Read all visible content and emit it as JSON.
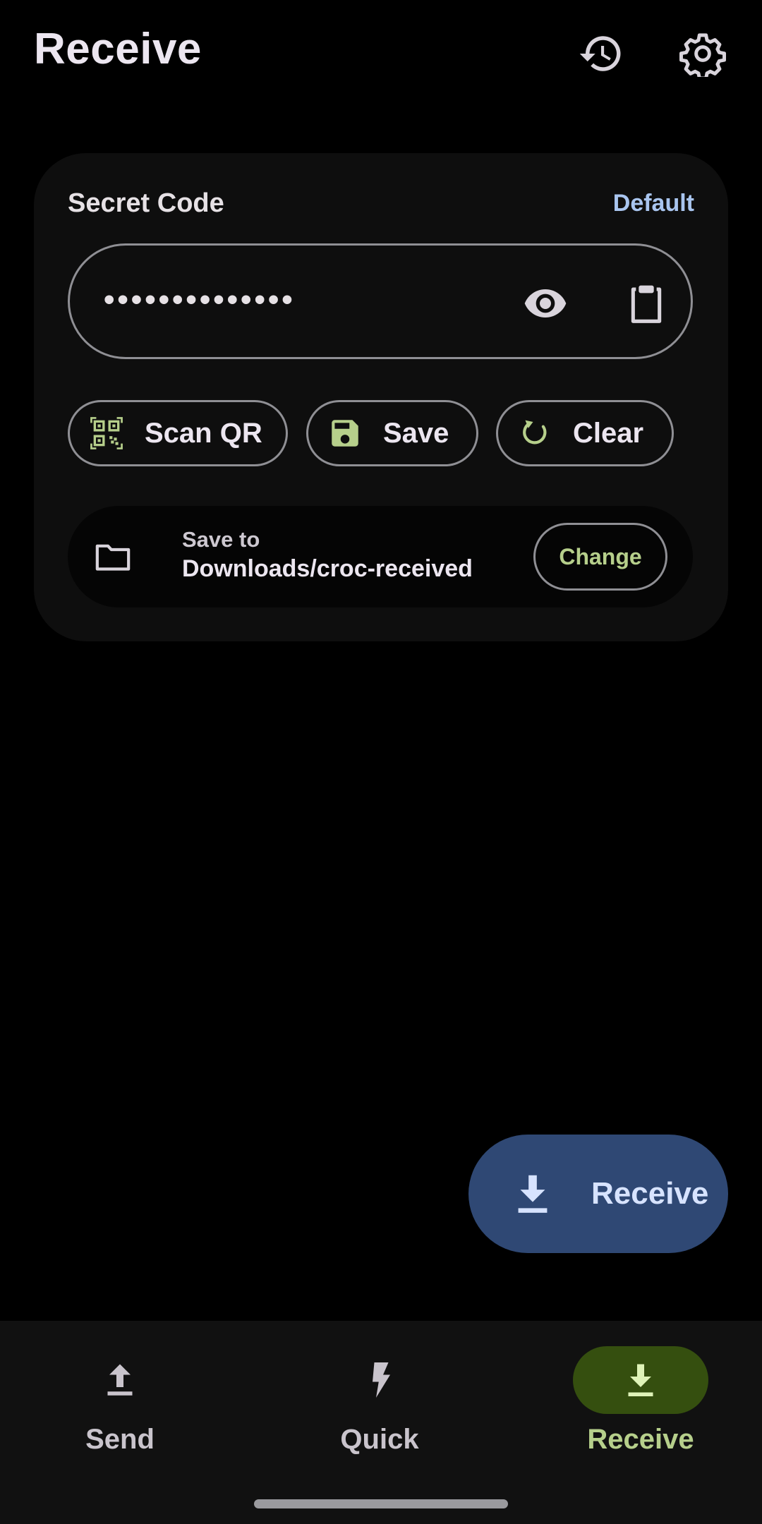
{
  "header": {
    "title": "Receive",
    "history_icon": "history-icon",
    "settings_icon": "gear-icon"
  },
  "code_card": {
    "label": "Secret Code",
    "default_link": "Default",
    "code_value": "••••••••••••••",
    "visibility_icon": "eye-icon",
    "paste_icon": "clipboard-icon",
    "actions": [
      {
        "label": "Scan QR",
        "icon": "qr-scan-icon"
      },
      {
        "label": "Save",
        "icon": "floppy-disk-icon"
      },
      {
        "label": "Clear",
        "icon": "refresh-icon"
      }
    ],
    "save_location": {
      "label": "Save to",
      "path": "Downloads/croc-received",
      "change_label": "Change",
      "icon": "folder-icon"
    }
  },
  "fab": {
    "label": "Receive",
    "icon": "download-icon"
  },
  "bottom_nav": {
    "items": [
      {
        "label": "Send",
        "icon": "upload-icon",
        "active": false
      },
      {
        "label": "Quick",
        "icon": "bolt-icon",
        "active": false
      },
      {
        "label": "Receive",
        "icon": "download-icon",
        "active": true
      }
    ]
  },
  "colors": {
    "background": "#000000",
    "surface": "#0e0e0e",
    "accent_green": "#b6cf8b",
    "accent_blue": "#a9c5ef",
    "fab_bg": "#2f4874",
    "active_pill": "#354f0f"
  }
}
